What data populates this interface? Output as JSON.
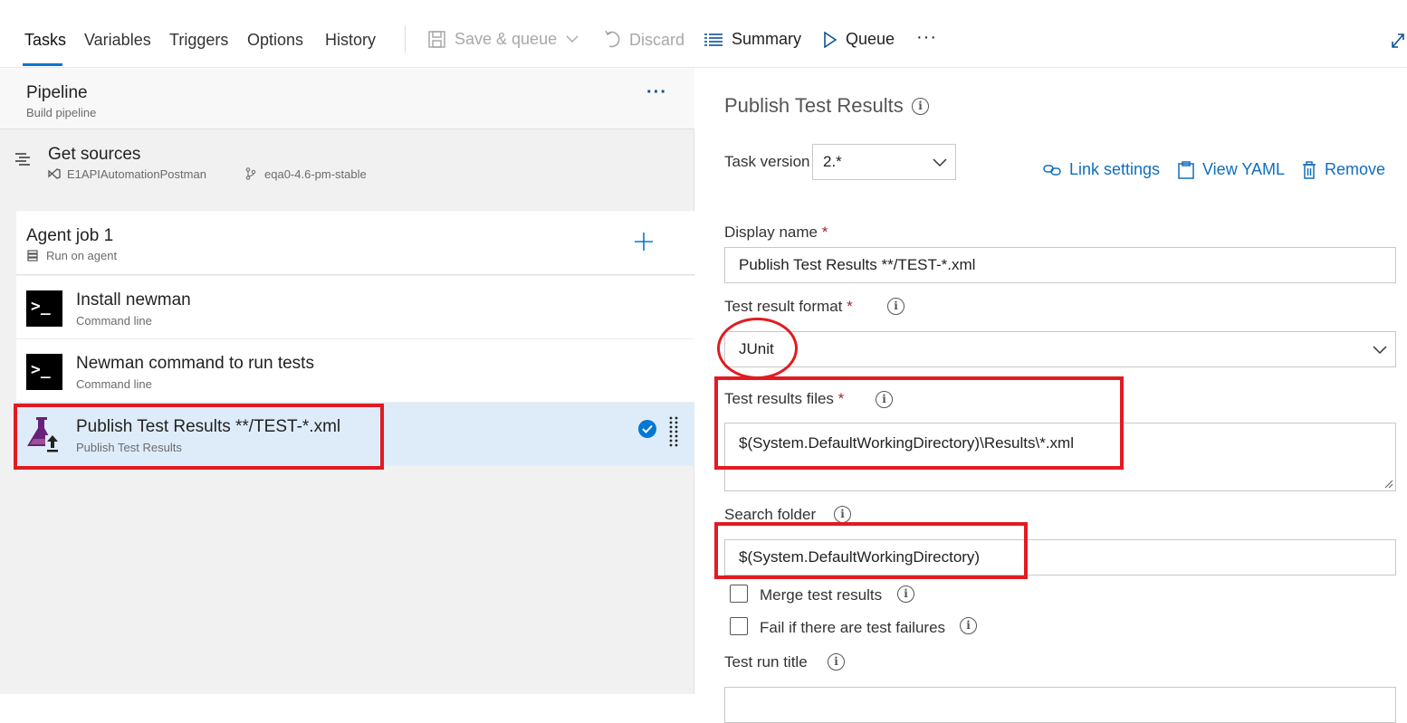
{
  "tabs": [
    {
      "label": "Tasks",
      "active": true
    },
    {
      "label": "Variables"
    },
    {
      "label": "Triggers"
    },
    {
      "label": "Options"
    },
    {
      "label": "History"
    }
  ],
  "toolbar": {
    "save_queue": "Save & queue",
    "discard": "Discard",
    "summary": "Summary",
    "queue": "Queue",
    "more": "···"
  },
  "pipeline": {
    "title": "Pipeline",
    "subtitle": "Build pipeline",
    "more": "···"
  },
  "get_sources": {
    "title": "Get sources",
    "repo": "E1APIAutomationPostman",
    "branch": "eqa0-4.6-pm-stable"
  },
  "agent_job": {
    "title": "Agent job 1",
    "subtitle": "Run on agent"
  },
  "tasks": [
    {
      "title": "Install newman",
      "subtitle": "Command line"
    },
    {
      "title": "Newman command to run tests",
      "subtitle": "Command line"
    },
    {
      "title": "Publish Test Results **/TEST-*.xml",
      "subtitle": "Publish Test Results",
      "selected": true
    }
  ],
  "detail": {
    "title": "Publish Test Results",
    "link_settings": "Link settings",
    "view_yaml": "View YAML",
    "remove": "Remove",
    "task_version_label": "Task version",
    "task_version_value": "2.*",
    "display_name_label": "Display name",
    "display_name_value": "Publish Test Results **/TEST-*.xml",
    "format_label": "Test result format",
    "format_value": "JUnit",
    "files_label": "Test results files",
    "files_value": "$(System.DefaultWorkingDirectory)\\Results\\*.xml",
    "search_folder_label": "Search folder",
    "search_folder_value": "$(System.DefaultWorkingDirectory)",
    "merge_label": "Merge test results",
    "fail_label": "Fail if there are test failures",
    "run_title_label": "Test run title",
    "required_mark": "*",
    "info_glyph": "i"
  },
  "colors": {
    "accent": "#0078d4",
    "annotation_red": "#e11b22",
    "selected_row": "#deecf9"
  }
}
